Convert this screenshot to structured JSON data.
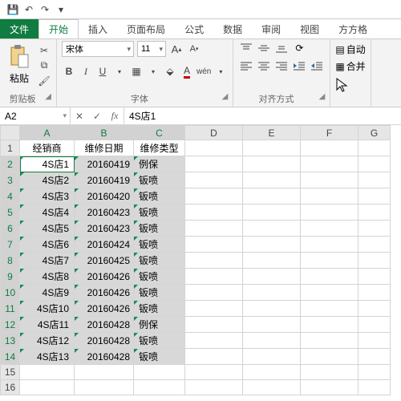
{
  "qat": {
    "save": "💾",
    "undo": "↶",
    "redo": "↷",
    "more": "▾"
  },
  "tabs": {
    "file": "文件",
    "items": [
      "开始",
      "插入",
      "页面布局",
      "公式",
      "数据",
      "审阅",
      "视图",
      "方方格"
    ],
    "active": 0
  },
  "ribbon": {
    "clipboard": {
      "label": "剪贴板",
      "paste": "粘贴"
    },
    "font": {
      "label": "字体",
      "name": "宋体",
      "size": "11",
      "increase": "A▴",
      "decrease": "A▾"
    },
    "alignment": {
      "label": "对齐方式"
    },
    "merge": "合并",
    "wrap": "自动"
  },
  "cellref": {
    "name": "A2",
    "value": "4S店1",
    "cancel": "✕",
    "confirm": "✓",
    "fx": "fx"
  },
  "columns": [
    "A",
    "B",
    "C",
    "D",
    "E",
    "F",
    "G"
  ],
  "headers": [
    "经销商",
    "维修日期",
    "维修类型"
  ],
  "rows": [
    [
      "4S店1",
      "20160419",
      "例保"
    ],
    [
      "4S店2",
      "20160419",
      "钣喷"
    ],
    [
      "4S店3",
      "20160420",
      "钣喷"
    ],
    [
      "4S店4",
      "20160423",
      "钣喷"
    ],
    [
      "4S店5",
      "20160423",
      "钣喷"
    ],
    [
      "4S店6",
      "20160424",
      "钣喷"
    ],
    [
      "4S店7",
      "20160425",
      "钣喷"
    ],
    [
      "4S店8",
      "20160426",
      "钣喷"
    ],
    [
      "4S店9",
      "20160426",
      "钣喷"
    ],
    [
      "4S店10",
      "20160426",
      "钣喷"
    ],
    [
      "4S店11",
      "20160428",
      "例保"
    ],
    [
      "4S店12",
      "20160428",
      "钣喷"
    ],
    [
      "4S店13",
      "20160428",
      "钣喷"
    ]
  ],
  "emptyRows": [
    15,
    16
  ],
  "selection": {
    "activeRow": 2,
    "activeCol": 0,
    "rows": [
      2,
      3,
      4,
      5,
      6,
      7,
      8,
      9,
      10,
      11,
      12,
      13,
      14
    ],
    "cols": [
      0,
      1,
      2
    ]
  }
}
